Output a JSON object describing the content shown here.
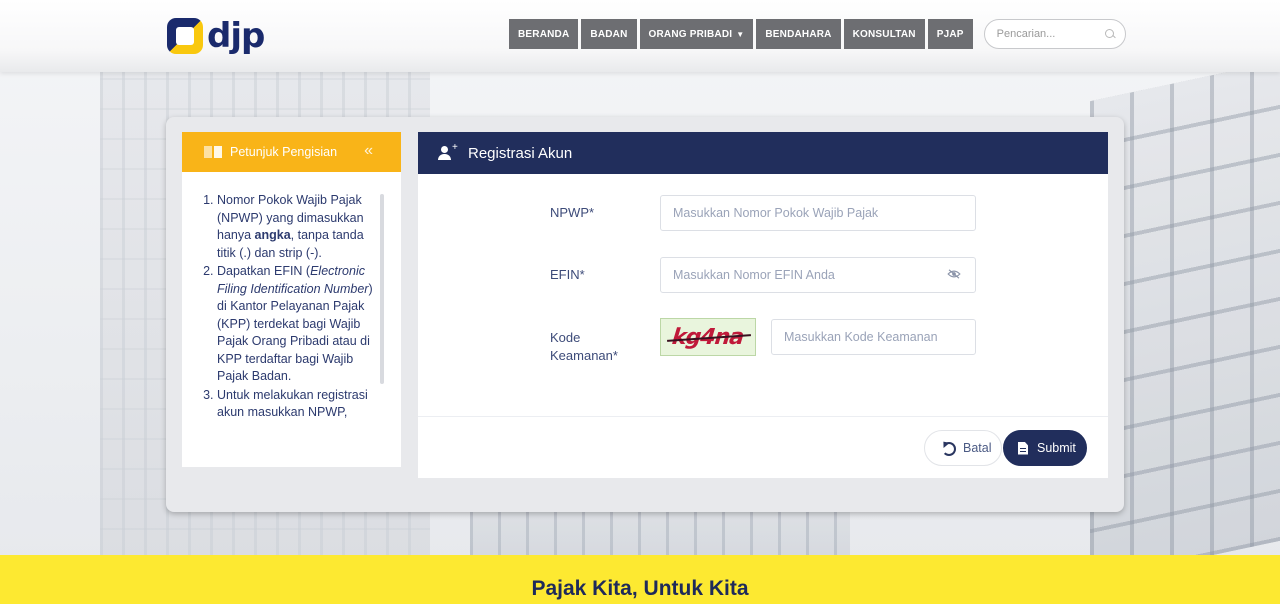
{
  "header": {
    "logo_text": "djp",
    "nav": [
      {
        "label": "BERANDA",
        "has_dropdown": false
      },
      {
        "label": "BADAN",
        "has_dropdown": false
      },
      {
        "label": "ORANG PRIBADI",
        "has_dropdown": true
      },
      {
        "label": "BENDAHARA",
        "has_dropdown": false
      },
      {
        "label": "KONSULTAN",
        "has_dropdown": false
      },
      {
        "label": "PJAP",
        "has_dropdown": false
      }
    ],
    "search": {
      "placeholder": "Pencarian...",
      "icon": "search-icon"
    }
  },
  "sidebar": {
    "title": "Petunjuk Pengisian",
    "title_icon": "book-icon",
    "collapse_icon": "double-chevron-left-icon",
    "items": [
      {
        "parts": [
          {
            "text": "Nomor Pokok Wajib Pajak (NPWP) yang dimasukkan hanya ",
            "style": "normal"
          },
          {
            "text": "angka",
            "style": "bold"
          },
          {
            "text": ", tanpa tanda titik (.) dan strip (-).",
            "style": "normal"
          }
        ]
      },
      {
        "parts": [
          {
            "text": "Dapatkan EFIN (",
            "style": "normal"
          },
          {
            "text": "Electronic Filing Identification Number",
            "style": "italic"
          },
          {
            "text": ") di Kantor Pelayanan Pajak (KPP) terdekat bagi Wajib Pajak Orang Pribadi atau di KPP terdaftar bagi Wajib Pajak Badan.",
            "style": "normal"
          }
        ]
      },
      {
        "parts": [
          {
            "text": "Untuk melakukan registrasi akun masukkan NPWP,",
            "style": "normal"
          }
        ]
      }
    ]
  },
  "form": {
    "title": "Registrasi Akun",
    "title_icon": "user-add-icon",
    "fields": {
      "npwp": {
        "label": "NPWP*",
        "placeholder": "Masukkan Nomor Pokok Wajib Pajak",
        "value": ""
      },
      "efin": {
        "label": "EFIN*",
        "placeholder": "Masukkan Nomor EFIN Anda",
        "value": "",
        "icon": "eye-off-icon"
      },
      "kode": {
        "label": "Kode Keamanan*",
        "placeholder": "Masukkan Kode Keamanan",
        "value": "",
        "captcha_text": "kg4na"
      }
    },
    "buttons": {
      "cancel": {
        "label": "Batal",
        "icon": "undo-icon"
      },
      "submit": {
        "label": "Submit",
        "icon": "file-icon"
      }
    }
  },
  "footer": {
    "text": "Pajak Kita, Untuk Kita"
  },
  "colors": {
    "navy": "#212e5c",
    "accent_yellow": "#f9b418",
    "footer_yellow": "#fde931",
    "nav_gray": "#6d6e72"
  }
}
